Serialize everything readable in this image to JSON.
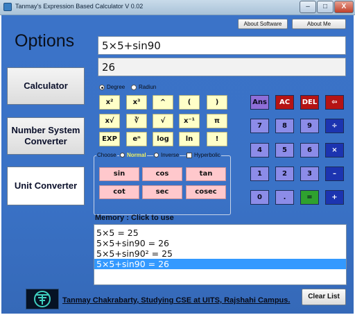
{
  "window": {
    "title": "Tanmay's Expression Based Calculator V 0.02",
    "minimize": "–",
    "maximize": "□",
    "close": "X"
  },
  "header_buttons": {
    "about_software": "About Software",
    "about_me": "About Me"
  },
  "sidebar": {
    "title": "Options",
    "items": [
      {
        "label": "Calculator",
        "selected": true
      },
      {
        "label": "Number System Converter",
        "selected": false
      },
      {
        "label": "Unit Converter",
        "selected": false
      }
    ]
  },
  "expression": {
    "value": "5×5+sin90",
    "result": "26"
  },
  "angle_mode": {
    "degree_label": "Degree",
    "radian_label": "Radiun",
    "selected": "Degree"
  },
  "scientific_keys": [
    [
      "x²",
      "x³",
      "^",
      "(",
      ")"
    ],
    [
      "x√",
      "∛",
      "√",
      "x⁻¹",
      "π"
    ],
    [
      "EXP",
      "eⁿ",
      "log",
      "ln",
      "!"
    ]
  ],
  "trig_group": {
    "choose_label": "Choose",
    "normal_label": "Normal",
    "inverse_label": "Inverse",
    "hyperbolic_label": "Hyperbolic",
    "selected": "Normal",
    "hyperbolic_checked": false,
    "keys": [
      [
        "sin",
        "cos",
        "tan"
      ],
      [
        "cot",
        "sec",
        "cosec"
      ]
    ]
  },
  "keypad": {
    "ans": "Ans",
    "ac": "AC",
    "del": "DEL",
    "backspace": "⇦",
    "rows": [
      [
        "7",
        "8",
        "9",
        "÷"
      ],
      [
        "4",
        "5",
        "6",
        "×"
      ],
      [
        "1",
        "2",
        "3",
        "–"
      ],
      [
        "0",
        ".",
        "=",
        "+"
      ]
    ]
  },
  "memory": {
    "label": "Memory : Click to use",
    "items": [
      "5×5 = 25",
      "5×5+sin90 = 26",
      "5×5+sin90² = 25",
      "5×5+sin90 = 26"
    ],
    "selected_index": 3
  },
  "footer": {
    "credit": "Tanmay Chakrabarty, Studying CSE at UITS, Rajshahi Campus.",
    "clear_list": "Clear List"
  }
}
